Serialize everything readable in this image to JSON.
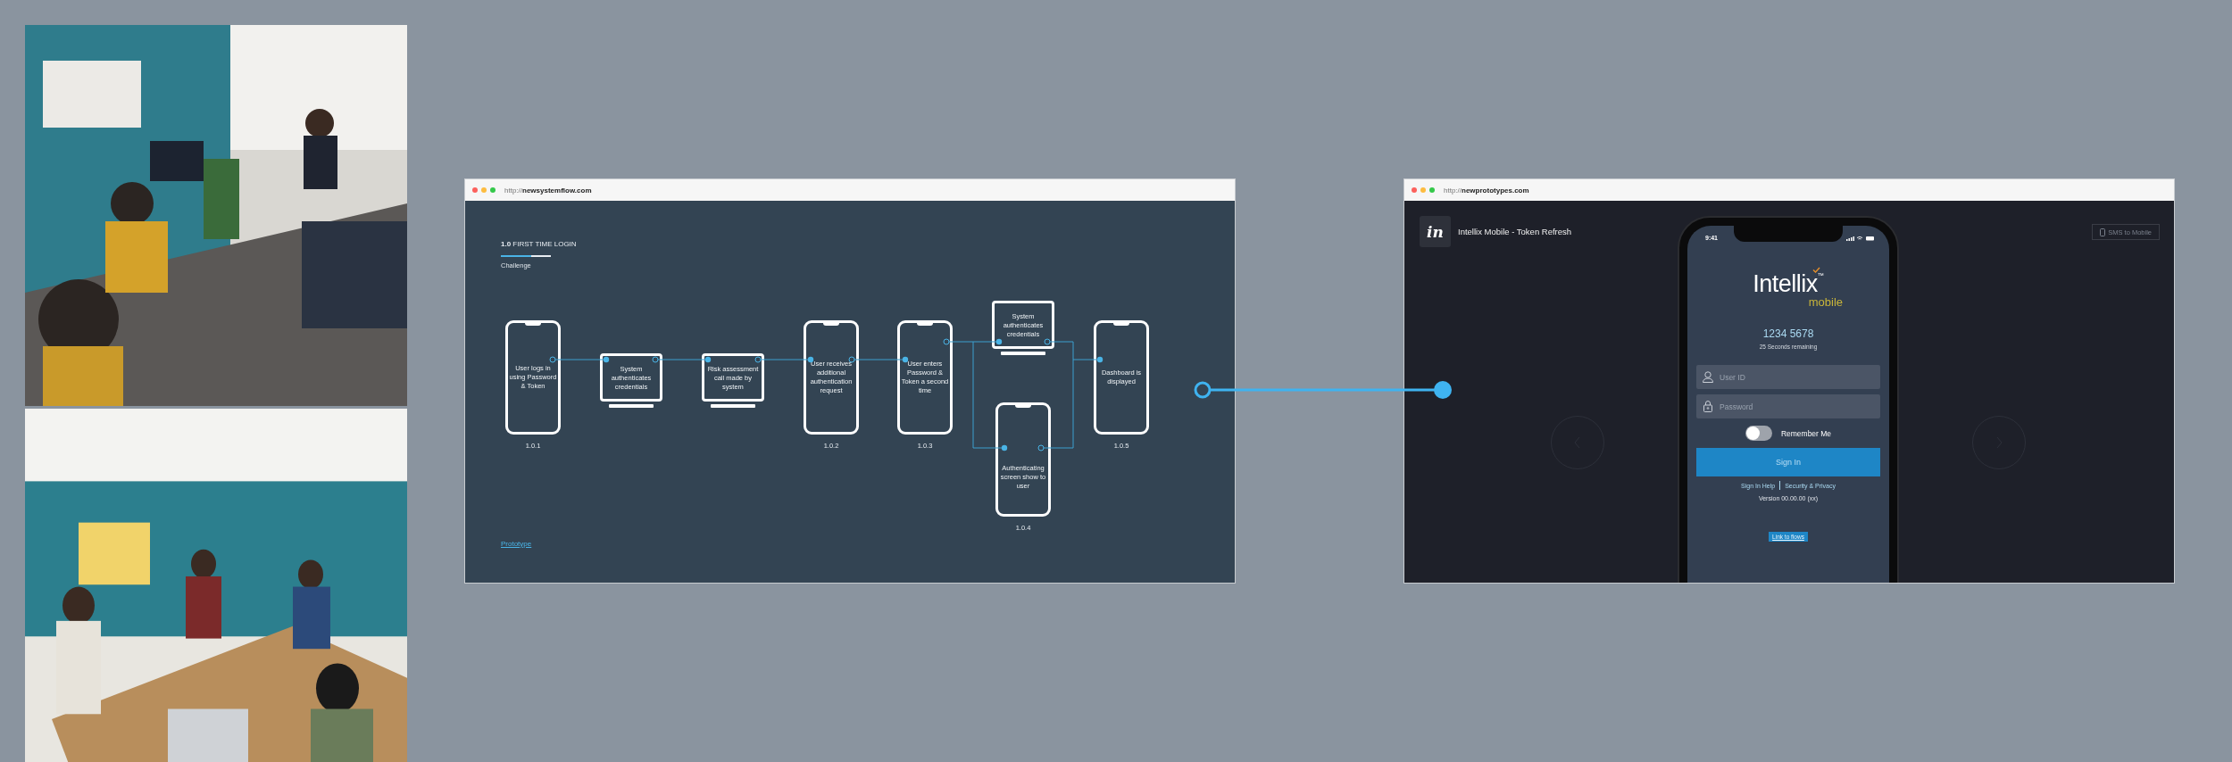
{
  "flow_window": {
    "url": "http://**newsystemflow.com**",
    "heading": "**1.0** FIRST TIME LOGIN",
    "subtitle": "Challenge",
    "nodes": [
      {
        "kind": "phone",
        "text": "User logs in using Password & Token",
        "label": "1.0.1"
      },
      {
        "kind": "monitor",
        "text": "System authenticates credentials"
      },
      {
        "kind": "monitor",
        "text": "Risk assessment call made by system"
      },
      {
        "kind": "phone",
        "text": "User receives additional authentication request",
        "label": "1.0.2"
      },
      {
        "kind": "phone",
        "text": "User enters Password & Token a second time",
        "label": "1.0.3"
      },
      {
        "kind": "monitor",
        "text": "System authenticates credentials"
      },
      {
        "kind": "phone",
        "text": "Authenticating screen show to user",
        "label": "1.0.4"
      },
      {
        "kind": "phone",
        "text": "Dashboard is displayed",
        "label": "1.0.5"
      }
    ],
    "link": "Prototype"
  },
  "prototype_window": {
    "url": "http://**newprototypes.com**",
    "logo_text": "in",
    "title": "Intellix Mobile - Token Refresh",
    "sms_button": "SMS to Mobile",
    "phone": {
      "time": "9:41",
      "brand": "Intellix",
      "trademark": "™",
      "brand_sub": "mobile",
      "code": "1234 5678",
      "remaining": "25 Seconds remaining",
      "fields": [
        {
          "kind": "user",
          "placeholder": "User ID"
        },
        {
          "kind": "lock",
          "placeholder": "Password"
        }
      ],
      "remember": {
        "label": "Remember Me",
        "on": false
      },
      "sign_in": "Sign In",
      "links": [
        "Sign In Help",
        "Security & Privacy"
      ],
      "version": "Version 00.00.00 (xx)",
      "flows_button": "Link to flows"
    }
  }
}
